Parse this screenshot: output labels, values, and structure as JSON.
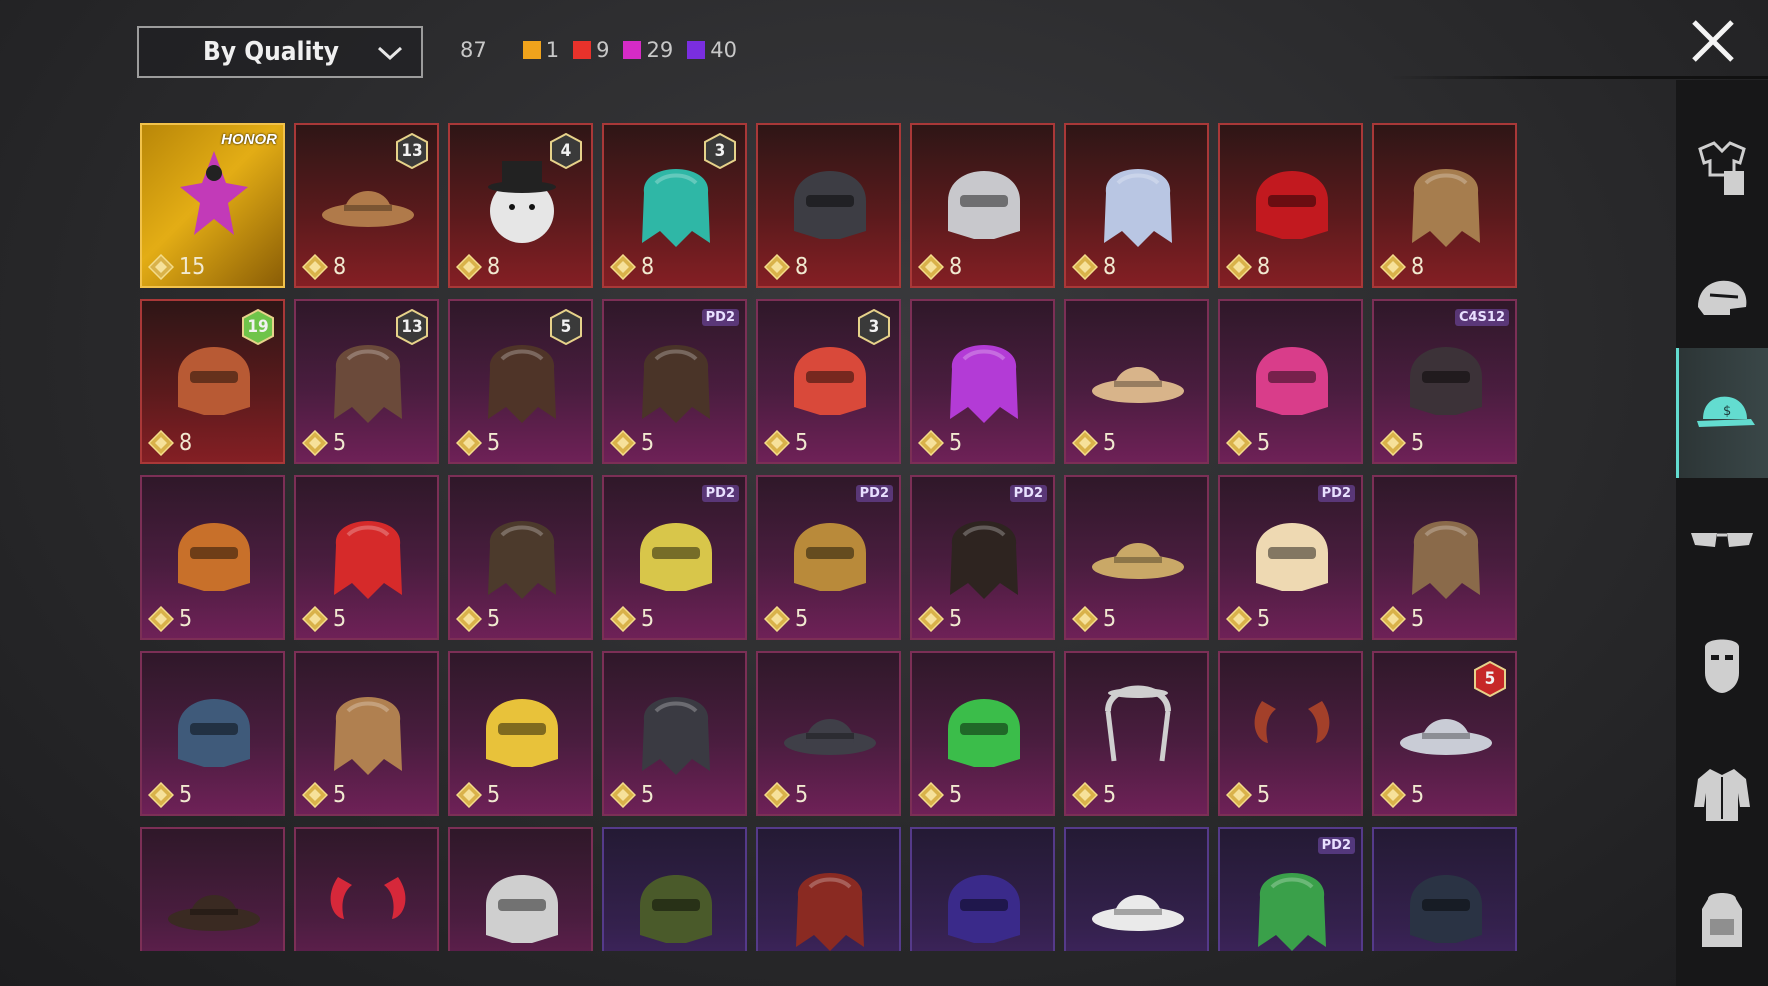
{
  "header": {
    "sort_label": "By Quality",
    "total_count": "87",
    "quality_counts": [
      {
        "color": "#f0a31c",
        "value": "1"
      },
      {
        "color": "#e8322b",
        "value": "9"
      },
      {
        "color": "#d52bc6",
        "value": "29"
      },
      {
        "color": "#7a2ee0",
        "value": "40"
      }
    ]
  },
  "sidebar": {
    "categories": [
      {
        "icon": "outfit-icon",
        "active": false
      },
      {
        "icon": "helmet-icon",
        "active": false
      },
      {
        "icon": "cap-icon",
        "active": true
      },
      {
        "icon": "glasses-icon",
        "active": false
      },
      {
        "icon": "mask-icon",
        "active": false
      },
      {
        "icon": "jacket-icon",
        "active": false
      },
      {
        "icon": "backpack-icon",
        "active": false
      }
    ]
  },
  "items": [
    {
      "quality": "gold",
      "cost": "15",
      "tag": "HONOR",
      "color": "#c23ab8",
      "shape": "crown"
    },
    {
      "quality": "red",
      "cost": "8",
      "badge": "13",
      "color": "#b07a4a",
      "shape": "hat"
    },
    {
      "quality": "red",
      "cost": "8",
      "badge": "4",
      "color": "#e6e6e6",
      "shape": "snowman"
    },
    {
      "quality": "red",
      "cost": "8",
      "badge": "3",
      "color": "#2fb7a6",
      "shape": "hair"
    },
    {
      "quality": "red",
      "cost": "8",
      "color": "#3d3d44",
      "shape": "helmet"
    },
    {
      "quality": "red",
      "cost": "8",
      "color": "#c8c8cc",
      "shape": "helmet"
    },
    {
      "quality": "red",
      "cost": "8",
      "color": "#b9c6e3",
      "shape": "hair"
    },
    {
      "quality": "red",
      "cost": "8",
      "color": "#c2191f",
      "shape": "helmet"
    },
    {
      "quality": "red",
      "cost": "8",
      "color": "#a67d4e",
      "shape": "hair"
    },
    {
      "quality": "red",
      "cost": "8",
      "badge": "19",
      "badge_color": "#6fc44a",
      "color": "#b85a34",
      "shape": "helmet"
    },
    {
      "quality": "purple",
      "cost": "5",
      "badge": "13",
      "color": "#6b4a3a",
      "shape": "hair"
    },
    {
      "quality": "purple",
      "cost": "5",
      "badge": "5",
      "color": "#4f3428",
      "shape": "hair"
    },
    {
      "quality": "purple",
      "cost": "5",
      "tag": "PD2",
      "color": "#4a3428",
      "shape": "hair"
    },
    {
      "quality": "purple",
      "cost": "5",
      "badge": "3",
      "color": "#d9493a",
      "shape": "helmet"
    },
    {
      "quality": "purple",
      "cost": "5",
      "color": "#b33bd6",
      "shape": "hair"
    },
    {
      "quality": "purple",
      "cost": "5",
      "color": "#d8b48a",
      "shape": "hat"
    },
    {
      "quality": "purple",
      "cost": "5",
      "color": "#d93d8a",
      "shape": "helmet"
    },
    {
      "quality": "purple",
      "cost": "5",
      "tag": "C4S12",
      "color": "#3c3238",
      "shape": "helmet"
    },
    {
      "quality": "purple",
      "cost": "5",
      "color": "#c8702a",
      "shape": "helmet"
    },
    {
      "quality": "purple",
      "cost": "5",
      "color": "#d62a2a",
      "shape": "hair"
    },
    {
      "quality": "purple",
      "cost": "5",
      "color": "#4c3a2c",
      "shape": "hair"
    },
    {
      "quality": "purple",
      "cost": "5",
      "tag": "PD2",
      "color": "#d8c64a",
      "shape": "helmet"
    },
    {
      "quality": "purple",
      "cost": "5",
      "tag": "PD2",
      "color": "#b98a3a",
      "shape": "helmet"
    },
    {
      "quality": "purple",
      "cost": "5",
      "tag": "PD2",
      "color": "#2e2420",
      "shape": "hair"
    },
    {
      "quality": "purple",
      "cost": "5",
      "color": "#c9a867",
      "shape": "hat"
    },
    {
      "quality": "purple",
      "cost": "5",
      "tag": "PD2",
      "color": "#eed9b2",
      "shape": "helmet"
    },
    {
      "quality": "purple",
      "cost": "5",
      "color": "#8a6a4a",
      "shape": "hair"
    },
    {
      "quality": "purple",
      "cost": "5",
      "color": "#3f5a7a",
      "shape": "helmet"
    },
    {
      "quality": "purple",
      "cost": "5",
      "color": "#b08050",
      "shape": "hair"
    },
    {
      "quality": "purple",
      "cost": "5",
      "color": "#e8c23a",
      "shape": "helmet"
    },
    {
      "quality": "purple",
      "cost": "5",
      "color": "#3a3a42",
      "shape": "hair"
    },
    {
      "quality": "purple",
      "cost": "5",
      "color": "#3f3f48",
      "shape": "hat"
    },
    {
      "quality": "purple",
      "cost": "5",
      "color": "#3bbd4a",
      "shape": "helmet"
    },
    {
      "quality": "purple",
      "cost": "5",
      "color": "#cfcfcf",
      "shape": "headband"
    },
    {
      "quality": "purple",
      "cost": "5",
      "color": "#a3402a",
      "shape": "horns"
    },
    {
      "quality": "purple",
      "cost": "5",
      "badge": "5",
      "badge_color": "#c62828",
      "color": "#c9ccd6",
      "shape": "hat"
    },
    {
      "quality": "purple",
      "cost": "",
      "color": "#3a2a22",
      "shape": "hat"
    },
    {
      "quality": "purple",
      "cost": "",
      "color": "#d6283a",
      "shape": "horns"
    },
    {
      "quality": "purple",
      "cost": "",
      "color": "#cfcfcf",
      "shape": "helmet"
    },
    {
      "quality": "blue",
      "cost": "",
      "color": "#4a5a2a",
      "shape": "helmet"
    },
    {
      "quality": "blue",
      "cost": "",
      "color": "#8a2a22",
      "shape": "hair"
    },
    {
      "quality": "blue",
      "cost": "",
      "color": "#3a2a8a",
      "shape": "helmet"
    },
    {
      "quality": "blue",
      "cost": "",
      "color": "#eaeaea",
      "shape": "hat"
    },
    {
      "quality": "blue",
      "cost": "",
      "tag": "PD2",
      "color": "#3aa04a",
      "shape": "hair"
    },
    {
      "quality": "blue",
      "cost": "",
      "color": "#2a3344",
      "shape": "helmet"
    }
  ]
}
